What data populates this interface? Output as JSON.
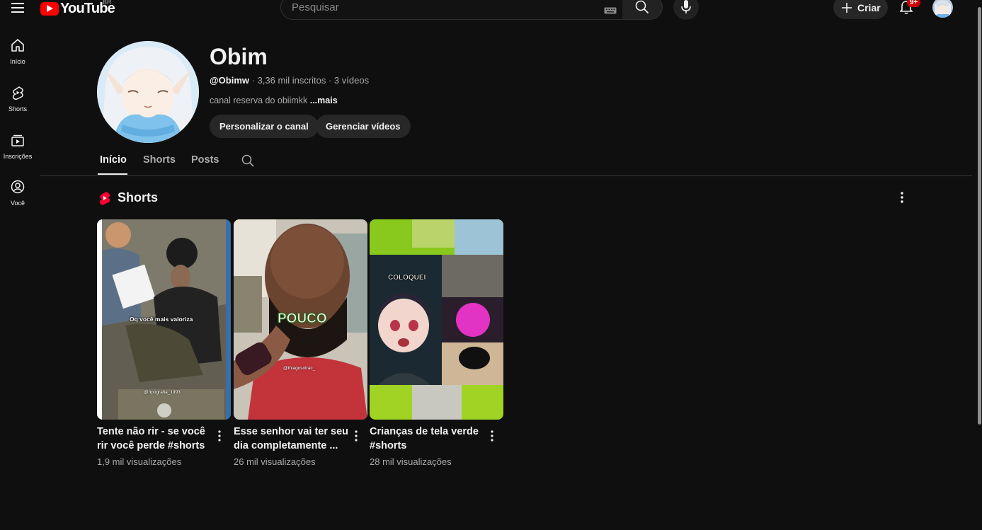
{
  "header": {
    "logo_text": "YouTube",
    "country_code": "BR",
    "search_placeholder": "Pesquisar",
    "create_label": "Criar",
    "notifications_badge": "9+"
  },
  "sidebar": {
    "items": [
      {
        "label": "Início",
        "icon": "home-icon"
      },
      {
        "label": "Shorts",
        "icon": "shorts-icon"
      },
      {
        "label": "Inscrições",
        "icon": "subscriptions-icon"
      },
      {
        "label": "Você",
        "icon": "you-icon"
      }
    ]
  },
  "channel": {
    "name": "Obim",
    "handle": "@Obimw",
    "meta": " · 3,36 mil inscritos · 3 vídeos",
    "description": "canal reserva do obiimkk ",
    "more_label": "...mais",
    "customize_label": "Personalizar o canal",
    "manage_label": "Gerenciar vídeos"
  },
  "tabs": [
    {
      "label": "Início",
      "active": true
    },
    {
      "label": "Shorts",
      "active": false
    },
    {
      "label": "Posts",
      "active": false
    }
  ],
  "shorts_section": {
    "title": "Shorts",
    "items": [
      {
        "title": "Tente não rir - se você rir você perde #shorts",
        "views": "1,9 mil visualizações",
        "caption": "Oq você mais valoriza",
        "watermark": "@hpografia_1993"
      },
      {
        "title": "Esse senhor vai ter seu dia completamente ...",
        "views": "26 mil visualizações",
        "caption": "POUCO",
        "watermark": "@thiagosolrac_"
      },
      {
        "title": "Crianças de tela verde #shorts",
        "views": "28 mil visualizações",
        "caption": "COLOQUEI"
      }
    ]
  },
  "colors": {
    "background": "#0f0f0f",
    "brand_red": "#ff0000",
    "pill_bg": "#272727",
    "muted_text": "#aaaaaa"
  }
}
